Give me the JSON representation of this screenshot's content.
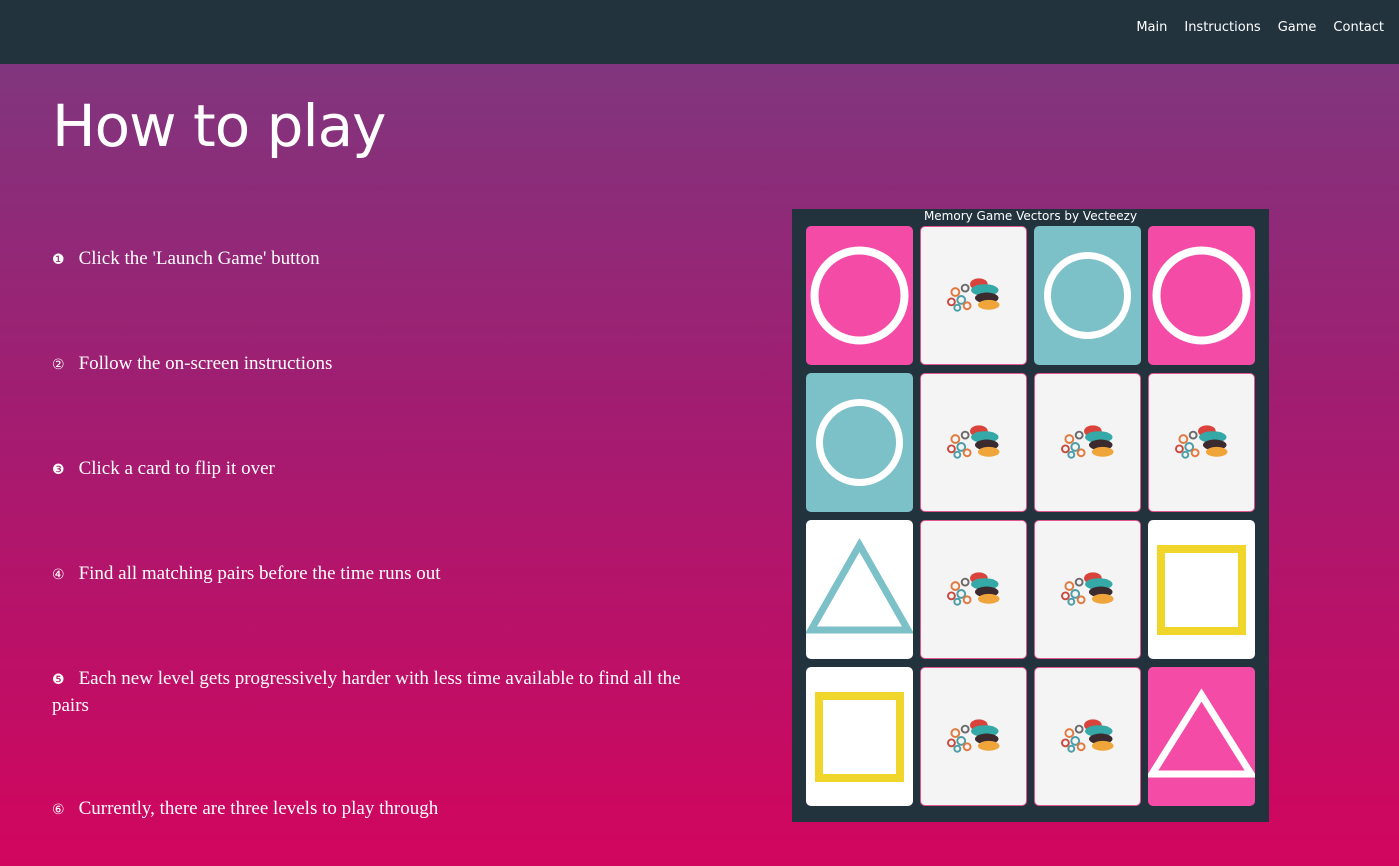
{
  "nav": {
    "links": [
      "Main",
      "Instructions",
      "Game",
      "Contact"
    ]
  },
  "page": {
    "title": "How to play"
  },
  "steps": [
    {
      "num": "❶",
      "text": "Click the 'Launch Game' button"
    },
    {
      "num": "②",
      "text": "Follow the on-screen instructions"
    },
    {
      "num": "❸",
      "text": "Click a card to flip it over"
    },
    {
      "num": "④",
      "text": "Find all matching pairs before the time runs out"
    },
    {
      "num": "❺",
      "text": "Each new level gets progressively harder with less time available to find all the pairs"
    },
    {
      "num": "⑥",
      "text": "Currently, there are three levels to play through"
    }
  ],
  "game": {
    "credit": "Memory Game Vectors by Vecteezy",
    "cards": [
      [
        "pink-circle",
        "card-back",
        "teal-circle",
        "pink-circle"
      ],
      [
        "teal-circle",
        "card-back",
        "card-back",
        "card-back"
      ],
      [
        "teal-triangle",
        "card-back",
        "card-back",
        "yellow-square"
      ],
      [
        "yellow-square",
        "card-back",
        "card-back",
        "pink-triangle"
      ]
    ]
  },
  "colors": {
    "navbar": "#22333e",
    "pink": "#f44ca6",
    "teal": "#7cc0c8",
    "yellow": "#f0d62a",
    "gradient_top": "#7a3a80",
    "gradient_bottom": "#d2055e"
  }
}
